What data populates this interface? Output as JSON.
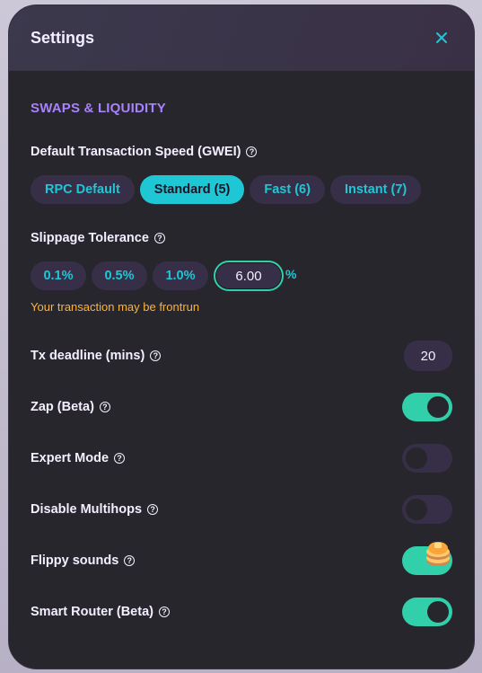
{
  "modal": {
    "title": "Settings",
    "close_icon": "close-icon"
  },
  "section": {
    "title": "SWAPS & LIQUIDITY"
  },
  "speed": {
    "label": "Default Transaction Speed (GWEI)",
    "options": [
      {
        "label": "RPC Default",
        "active": false
      },
      {
        "label": "Standard (5)",
        "active": true
      },
      {
        "label": "Fast (6)",
        "active": false
      },
      {
        "label": "Instant (7)",
        "active": false
      }
    ]
  },
  "slippage": {
    "label": "Slippage Tolerance",
    "options": [
      "0.1%",
      "0.5%",
      "1.0%"
    ],
    "value": "6.00",
    "unit": "%",
    "warning": "Your transaction may be frontrun"
  },
  "deadline": {
    "label": "Tx deadline (mins)",
    "value": "20"
  },
  "toggles": [
    {
      "label": "Zap (Beta)",
      "on": true
    },
    {
      "label": "Expert Mode",
      "on": false
    },
    {
      "label": "Disable Multihops",
      "on": false
    },
    {
      "label": "Flippy sounds",
      "on": true
    },
    {
      "label": "Smart Router (Beta)",
      "on": true
    }
  ],
  "colors": {
    "primary": "#1fc7d4",
    "secondary": "#a881fc",
    "success": "#31d0aa",
    "warning": "#ffb237",
    "background": "#27262c",
    "input": "#372f47",
    "text": "#f4eeff"
  }
}
